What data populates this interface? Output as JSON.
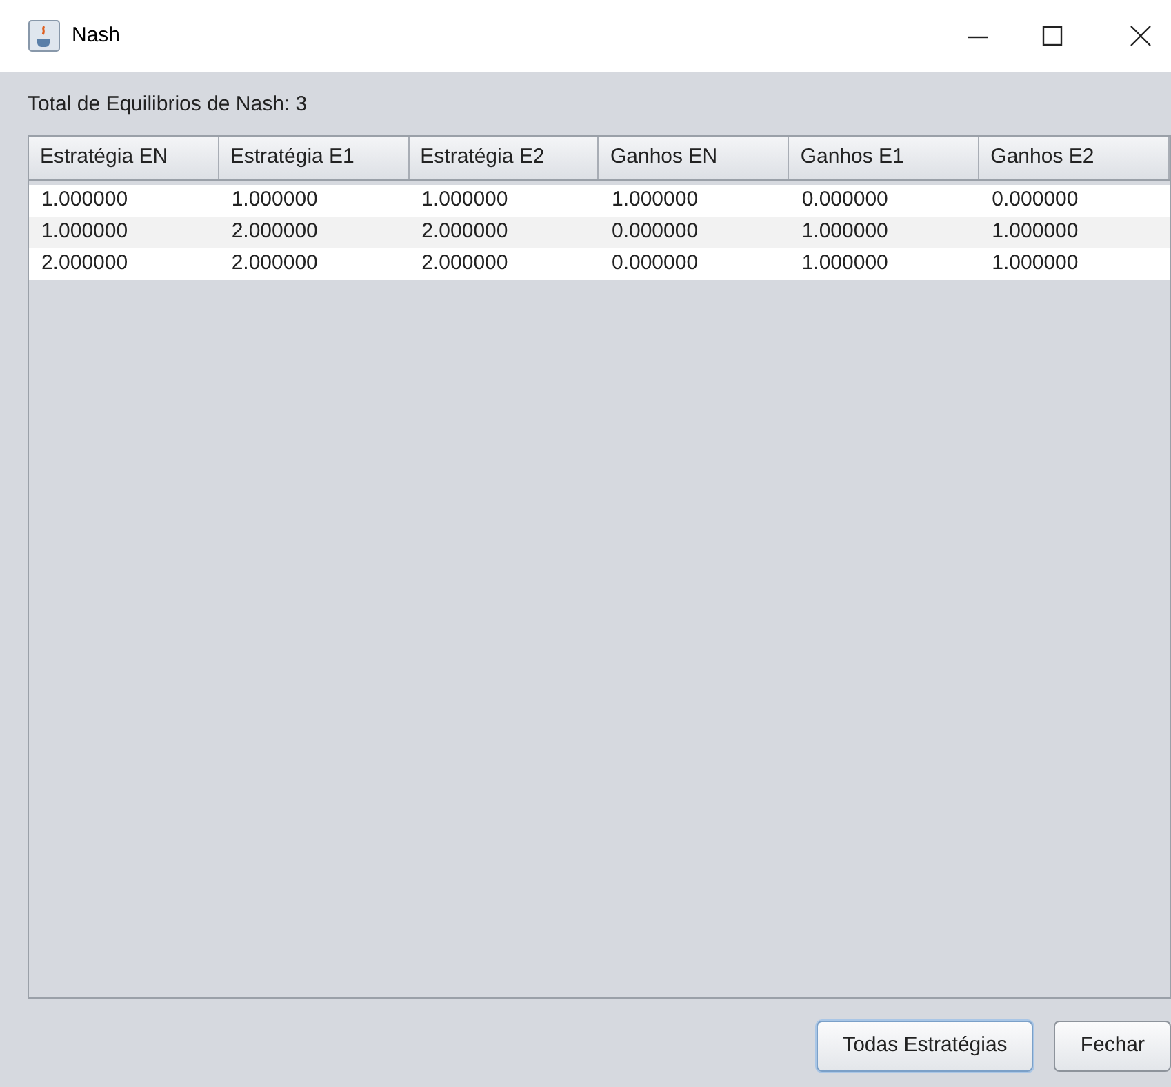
{
  "window": {
    "title": "Nash"
  },
  "summary": "Total de Equilibrios de Nash: 3",
  "table": {
    "columns": [
      "Estratégia EN",
      "Estratégia E1",
      "Estratégia E2",
      "Ganhos EN",
      "Ganhos E1",
      "Ganhos E2"
    ],
    "rows": [
      [
        "1.000000",
        "1.000000",
        "1.000000",
        "1.000000",
        "0.000000",
        "0.000000"
      ],
      [
        "1.000000",
        "2.000000",
        "2.000000",
        "0.000000",
        "1.000000",
        "1.000000"
      ],
      [
        "2.000000",
        "2.000000",
        "2.000000",
        "0.000000",
        "1.000000",
        "1.000000"
      ]
    ]
  },
  "buttons": [
    {
      "label": "Todas Estratégias",
      "focused": true
    },
    {
      "label": "Fechar",
      "focused": false
    }
  ]
}
